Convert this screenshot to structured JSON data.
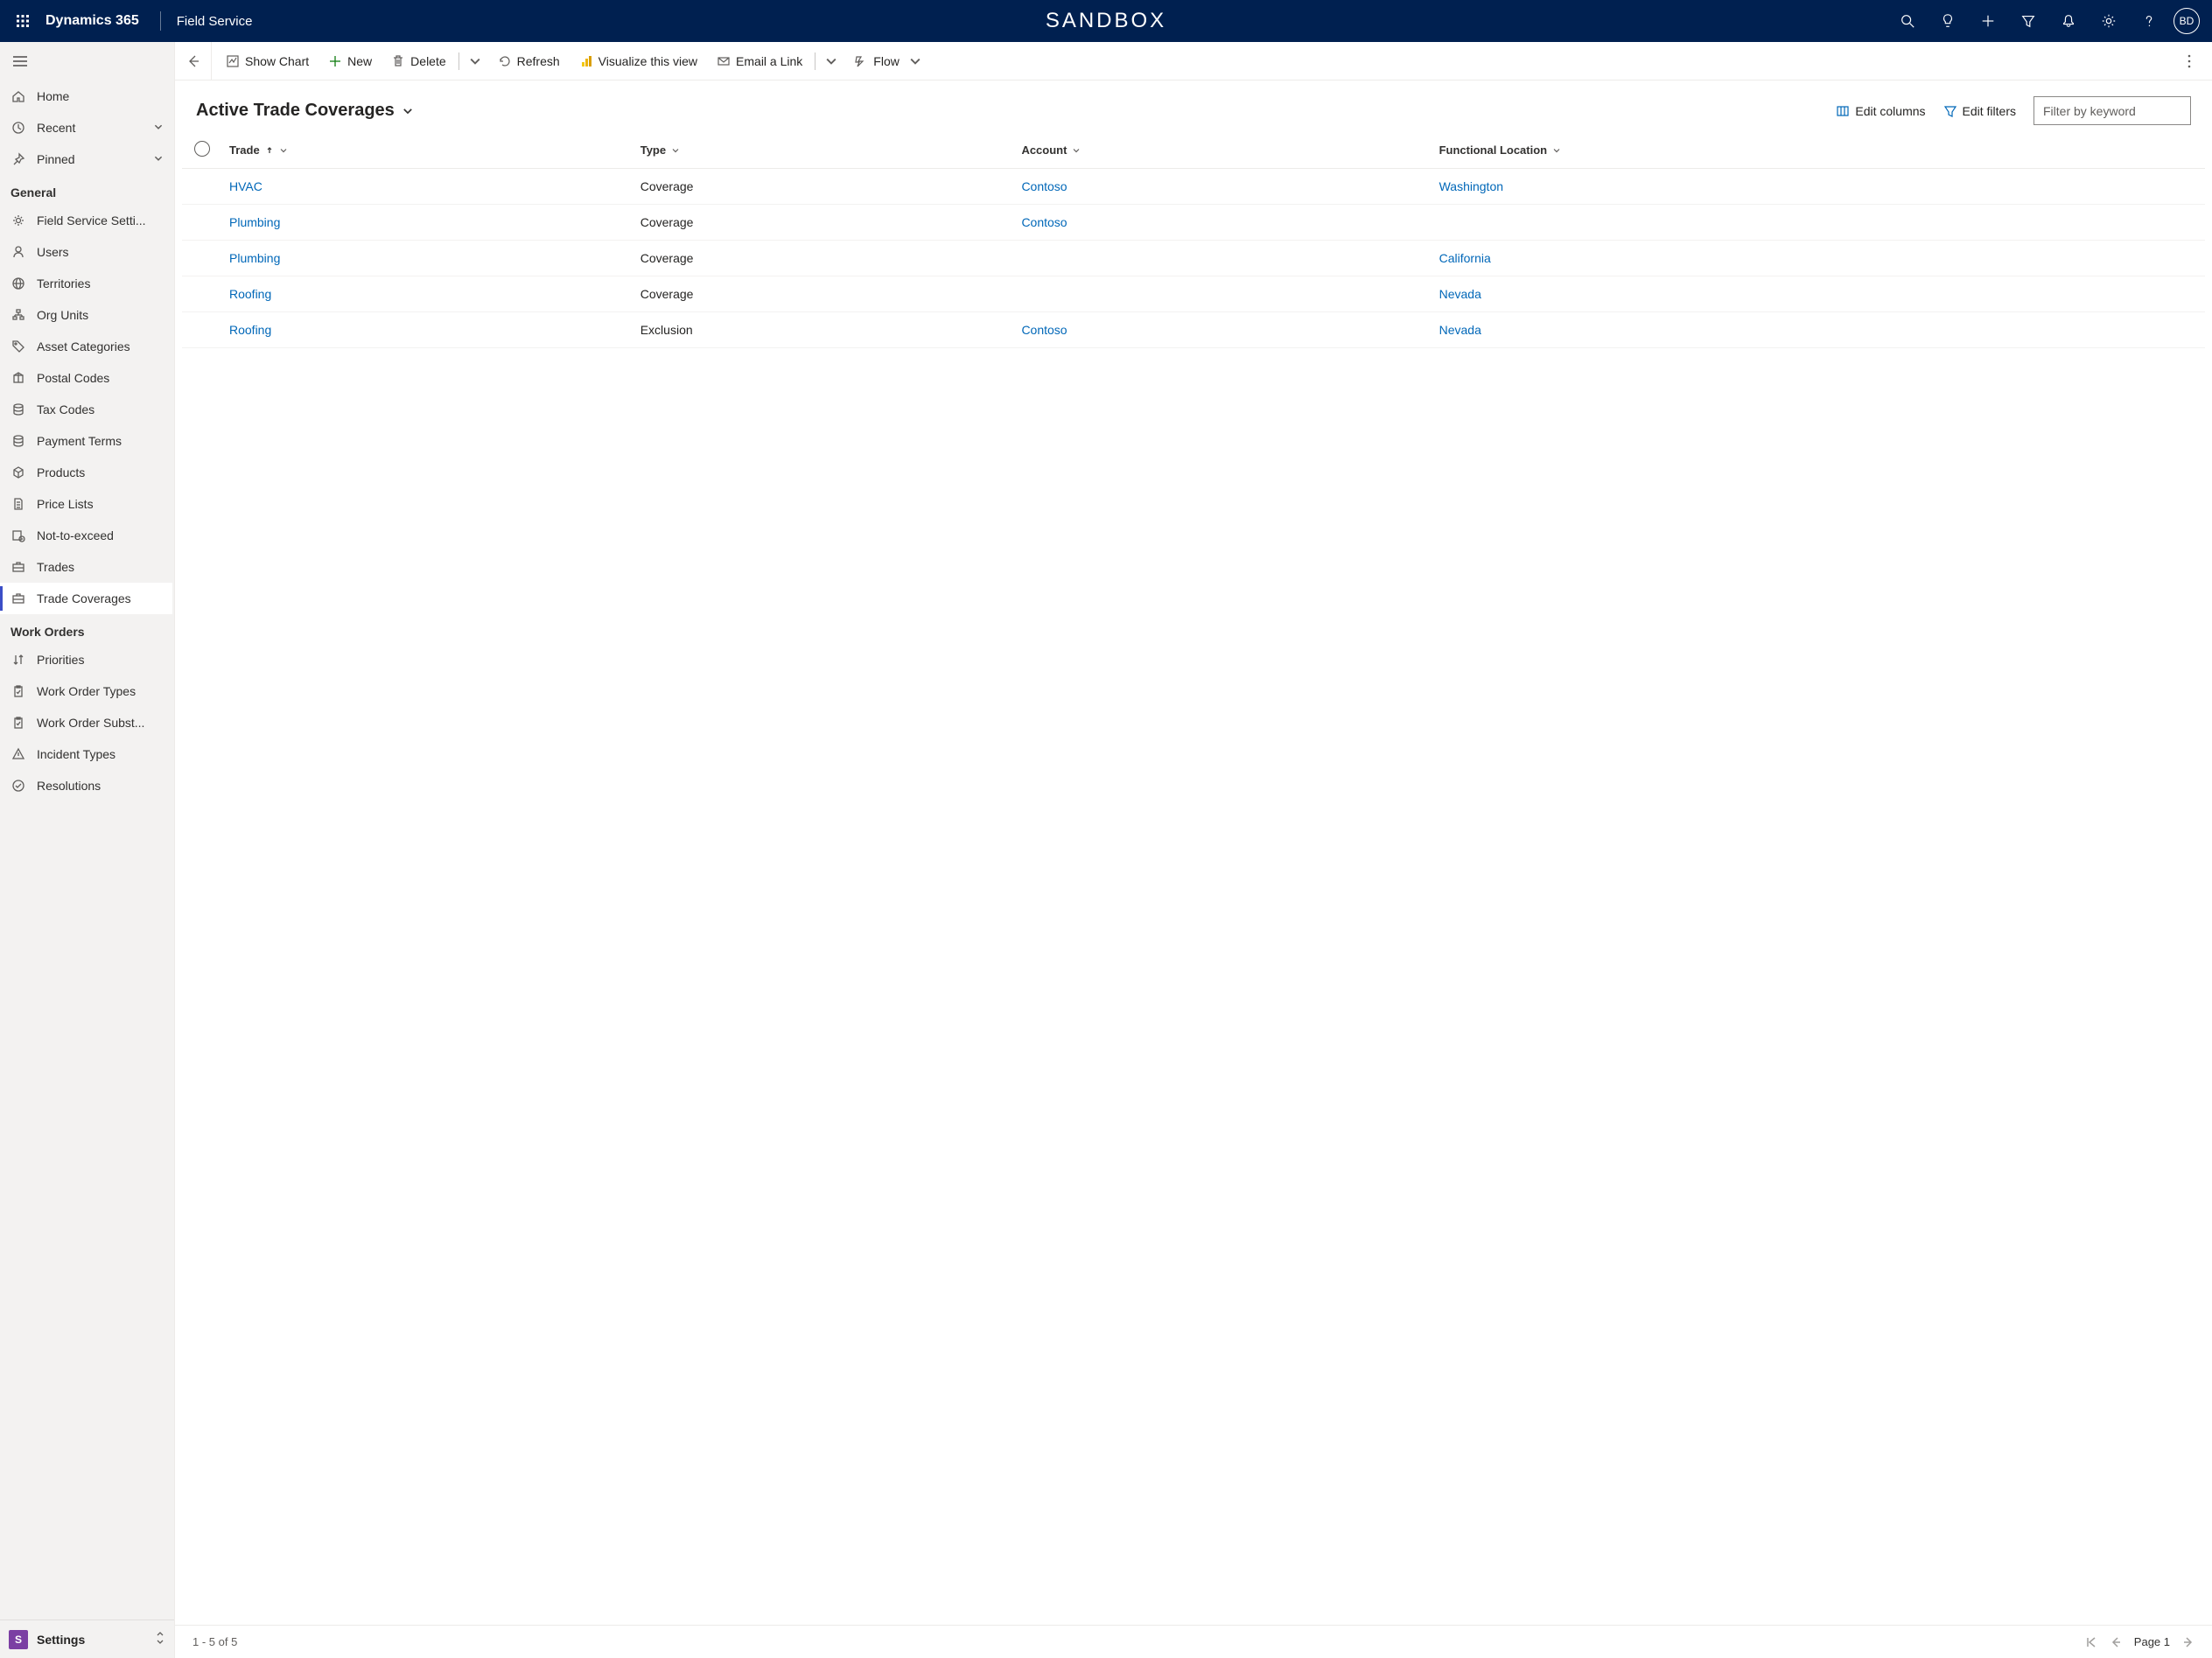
{
  "top": {
    "brand": "Dynamics 365",
    "app": "Field Service",
    "env": "SANDBOX",
    "avatar": "BD"
  },
  "sidebar": {
    "top_items": [
      {
        "label": "Home",
        "icon": "home"
      },
      {
        "label": "Recent",
        "icon": "clock",
        "chev": true
      },
      {
        "label": "Pinned",
        "icon": "pin",
        "chev": true
      }
    ],
    "groups": [
      {
        "header": "General",
        "items": [
          {
            "label": "Field Service Setti...",
            "icon": "gear"
          },
          {
            "label": "Users",
            "icon": "person"
          },
          {
            "label": "Territories",
            "icon": "globe"
          },
          {
            "label": "Org Units",
            "icon": "org"
          },
          {
            "label": "Asset Categories",
            "icon": "tag"
          },
          {
            "label": "Postal Codes",
            "icon": "package"
          },
          {
            "label": "Tax Codes",
            "icon": "db"
          },
          {
            "label": "Payment Terms",
            "icon": "db"
          },
          {
            "label": "Products",
            "icon": "product"
          },
          {
            "label": "Price Lists",
            "icon": "doc"
          },
          {
            "label": "Not-to-exceed",
            "icon": "nte"
          },
          {
            "label": "Trades",
            "icon": "briefcase"
          },
          {
            "label": "Trade Coverages",
            "icon": "briefcase",
            "selected": true
          }
        ]
      },
      {
        "header": "Work Orders",
        "items": [
          {
            "label": "Priorities",
            "icon": "sort"
          },
          {
            "label": "Work Order Types",
            "icon": "clipboard"
          },
          {
            "label": "Work Order Subst...",
            "icon": "clipboard"
          },
          {
            "label": "Incident Types",
            "icon": "warning"
          },
          {
            "label": "Resolutions",
            "icon": "check"
          }
        ]
      }
    ],
    "app_switch": {
      "badge": "S",
      "label": "Settings"
    }
  },
  "cmdbar": {
    "showChart": "Show Chart",
    "new": "New",
    "delete": "Delete",
    "refresh": "Refresh",
    "visualize": "Visualize this view",
    "email": "Email a Link",
    "flow": "Flow"
  },
  "view": {
    "title": "Active Trade Coverages",
    "editColumns": "Edit columns",
    "editFilters": "Edit filters",
    "filterPlaceholder": "Filter by keyword"
  },
  "grid": {
    "columns": [
      {
        "label": "Trade",
        "sort": "asc"
      },
      {
        "label": "Type"
      },
      {
        "label": "Account"
      },
      {
        "label": "Functional Location"
      }
    ],
    "rows": [
      {
        "trade": "HVAC",
        "type": "Coverage",
        "account": "Contoso",
        "loc": "Washington"
      },
      {
        "trade": "Plumbing",
        "type": "Coverage",
        "account": "Contoso",
        "loc": ""
      },
      {
        "trade": "Plumbing",
        "type": "Coverage",
        "account": "",
        "loc": "California"
      },
      {
        "trade": "Roofing",
        "type": "Coverage",
        "account": "",
        "loc": "Nevada"
      },
      {
        "trade": "Roofing",
        "type": "Exclusion",
        "account": "Contoso",
        "loc": "Nevada"
      }
    ]
  },
  "status": {
    "range": "1 - 5 of 5",
    "page": "Page 1"
  }
}
